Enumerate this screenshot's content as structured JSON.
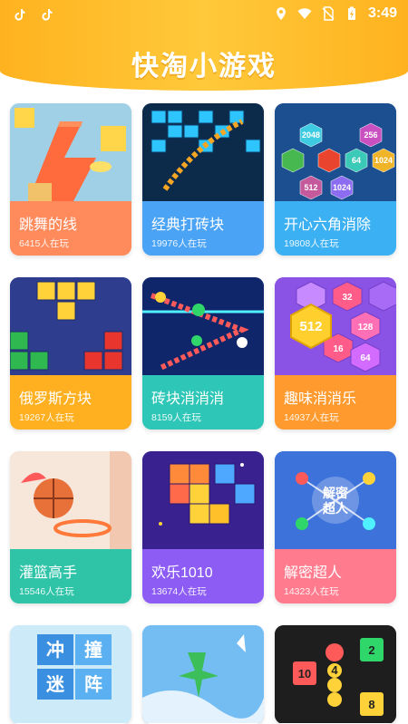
{
  "status_bar": {
    "time": "3:49"
  },
  "header": {
    "title": "快淘小游戏"
  },
  "games": [
    {
      "name": "跳舞的线",
      "players": "6415人在玩",
      "icon": "dancing-line-thumbnail",
      "color": "#ff8a5b"
    },
    {
      "name": "经典打砖块",
      "players": "19976人在玩",
      "icon": "brick-breaker-thumbnail",
      "color": "#4aa3f5"
    },
    {
      "name": "开心六角消除",
      "players": "19808人在玩",
      "icon": "hexagon-merge-thumbnail",
      "color": "#3bb0f2"
    },
    {
      "name": "俄罗斯方块",
      "players": "19267人在玩",
      "icon": "tetris-thumbnail",
      "color": "#ffb020"
    },
    {
      "name": "砖块消消消",
      "players": "8159人在玩",
      "icon": "brick-shooter-thumbnail",
      "color": "#2ec7b7"
    },
    {
      "name": "趣味消消乐",
      "players": "14937人在玩",
      "icon": "hex-512-thumbnail",
      "color": "#ff9a2e"
    },
    {
      "name": "灌篮高手",
      "players": "15546人在玩",
      "icon": "basketball-thumbnail",
      "color": "#2fc4a8"
    },
    {
      "name": "欢乐1010",
      "players": "13674人在玩",
      "icon": "block-1010-thumbnail",
      "color": "#8c5cf5"
    },
    {
      "name": "解密超人",
      "players": "14323人在玩",
      "icon": "puzzle-hero-thumbnail",
      "color": "#ff7b8d"
    },
    {
      "name": "",
      "players": "",
      "icon": "ice-puzzle-thumbnail",
      "color": "#5aa9f5"
    },
    {
      "name": "",
      "players": "",
      "icon": "plane-thumbnail",
      "color": "#6bb6f0"
    },
    {
      "name": "",
      "players": "",
      "icon": "snake-numbers-thumbnail",
      "color": "#222222"
    }
  ]
}
